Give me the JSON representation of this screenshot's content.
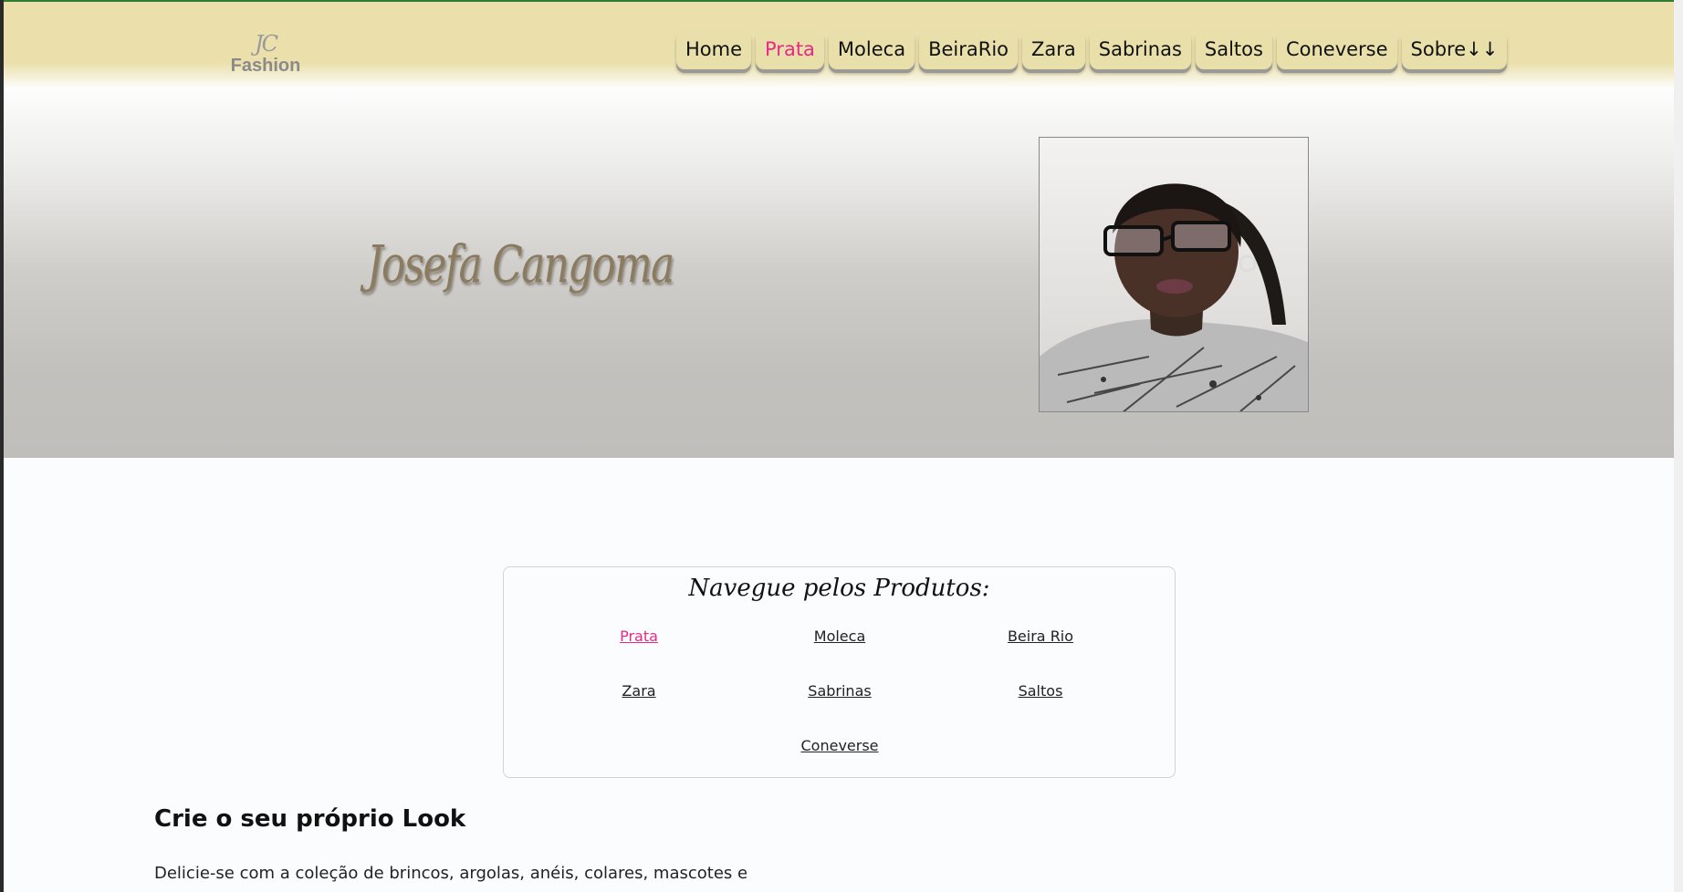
{
  "header": {
    "logo": {
      "mark": "JC",
      "text": "Fashion"
    },
    "nav": [
      {
        "label": "Home",
        "active": false
      },
      {
        "label": "Prata",
        "active": true
      },
      {
        "label": "Moleca",
        "active": false
      },
      {
        "label": "BeiraRio",
        "active": false
      },
      {
        "label": "Zara",
        "active": false
      },
      {
        "label": "Sabrinas",
        "active": false
      },
      {
        "label": "Saltos",
        "active": false
      },
      {
        "label": "Coneverse",
        "active": false
      },
      {
        "label": "Sobre↓↓",
        "active": false
      }
    ]
  },
  "hero": {
    "name": "Josefa Cangoma"
  },
  "products": {
    "title": "Navegue pelos Produtos:",
    "links": [
      "Prata",
      "Moleca",
      "Beira Rio",
      "Zara",
      "Sabrinas",
      "Saltos",
      "Coneverse"
    ]
  },
  "look": {
    "title": "Crie o seu próprio Look",
    "text": "Delicie-se com a coleção de brincos, argolas, anéis, colares, mascotes e"
  },
  "colors": {
    "accent": "#e62a86",
    "header_bg": "#ebe0ac",
    "name_color": "#8b7c61"
  }
}
